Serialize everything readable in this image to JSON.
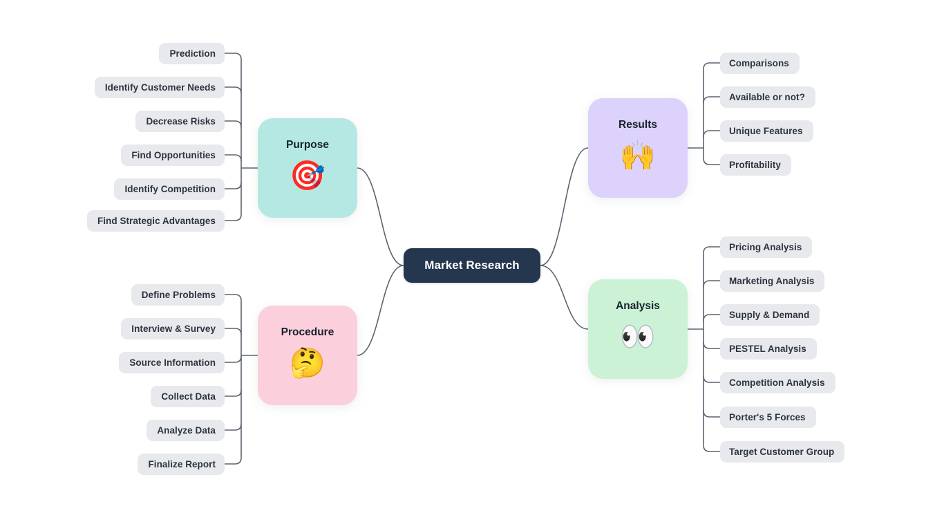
{
  "diagram": {
    "title": "Market Research",
    "type": "mind-map",
    "background_color": "#ffffff",
    "center": {
      "label": "Market Research",
      "color": "#25374f",
      "text_color": "#ffffff"
    },
    "edge_color": "#5c6370",
    "leaf_style": {
      "background_color": "#e7e9ec",
      "text_color": "#2c3440"
    },
    "branches": [
      {
        "id": "purpose",
        "label": "Purpose",
        "emoji": "🎯",
        "emoji_name": "direct-hit-target-icon",
        "color": "#b5e8e3",
        "side": "left",
        "leaves": [
          "Prediction",
          "Identify Customer Needs",
          "Decrease Risks",
          "Find Opportunities",
          "Identify Competition",
          "Find Strategic Advantages"
        ]
      },
      {
        "id": "procedure",
        "label": "Procedure",
        "emoji": "🤔",
        "emoji_name": "thinking-face-icon",
        "color": "#fbcfdb",
        "side": "left",
        "leaves": [
          "Define Problems",
          "Interview & Survey",
          "Source Information",
          "Collect Data",
          "Analyze Data",
          "Finalize Report"
        ]
      },
      {
        "id": "results",
        "label": "Results",
        "emoji": "🙌",
        "emoji_name": "raising-hands-icon",
        "color": "#ddd2fb",
        "side": "right",
        "leaves": [
          "Comparisons",
          "Available or not?",
          "Unique Features",
          "Profitability"
        ]
      },
      {
        "id": "analysis",
        "label": "Analysis",
        "emoji": "👀",
        "emoji_name": "eyes-icon",
        "color": "#ccf2d5",
        "side": "right",
        "leaves": [
          "Pricing Analysis",
          "Marketing Analysis",
          "Supply & Demand",
          "PESTEL Analysis",
          "Competition Analysis",
          "Porter's 5 Forces",
          "Target Customer Group"
        ]
      }
    ]
  }
}
